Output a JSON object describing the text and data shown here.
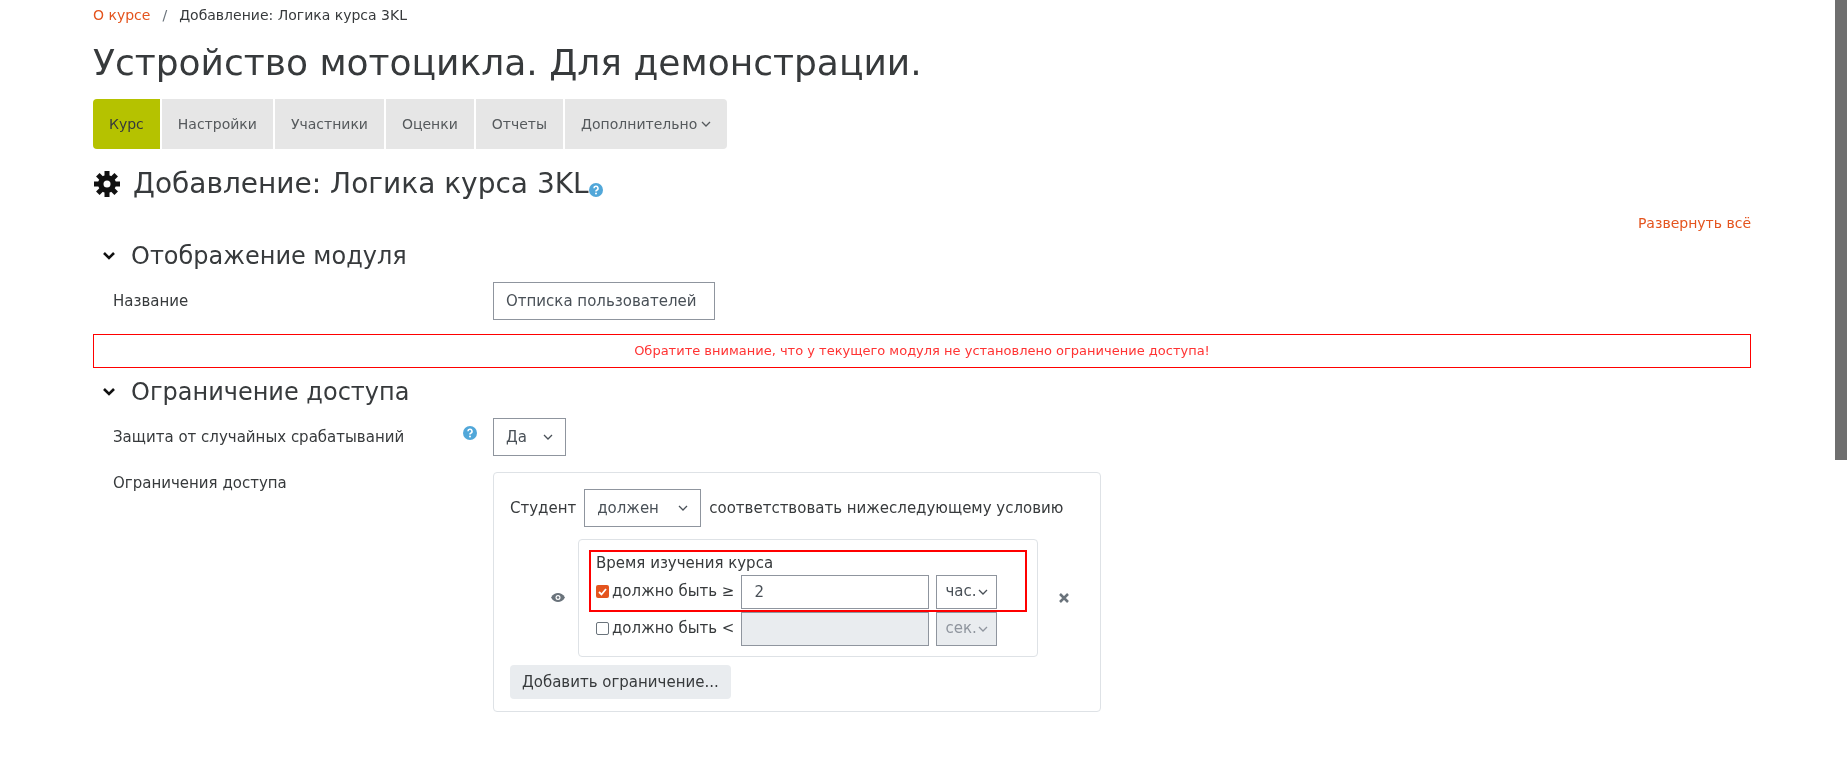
{
  "breadcrumb_separator": "/",
  "breadcrumb": [
    {
      "label": "О курсе",
      "link": true
    },
    {
      "label": "Добавление: Логика курса 3KL",
      "link": false
    }
  ],
  "course_title": "Устройство мотоцикла. Для демонстрации.",
  "tabs": [
    {
      "label": "Курс",
      "selected": true,
      "dropdown": false
    },
    {
      "label": "Настройки",
      "selected": false,
      "dropdown": false
    },
    {
      "label": "Участники",
      "selected": false,
      "dropdown": false
    },
    {
      "label": "Оценки",
      "selected": false,
      "dropdown": false
    },
    {
      "label": "Отчеты",
      "selected": false,
      "dropdown": false
    },
    {
      "label": "Дополнительно",
      "selected": false,
      "dropdown": true
    }
  ],
  "page_heading": "Добавление: Логика курса 3KL",
  "expand_all": "Развернуть всё",
  "sections": [
    {
      "title": "Отображение модуля",
      "expanded": true,
      "fields": [
        {
          "kind": "text",
          "label": "Название",
          "value": "Отписка пользователей"
        }
      ],
      "alert": "Обратите внимание, что у текущего модуля не установлено ограничение доступа!"
    },
    {
      "title": "Ограничение доступа",
      "expanded": true,
      "fields": [
        {
          "kind": "select",
          "label": "Защита от случайных срабатываний",
          "help": true,
          "value": "Да"
        },
        {
          "kind": "restrictions",
          "label": "Ограничения доступа"
        }
      ]
    }
  ],
  "restrictions": {
    "prefix": "Студент",
    "mode": "должен",
    "suffix": "соответствовать нижеследующему условию",
    "condition": {
      "title": "Время изучения курса",
      "highlighted": true,
      "rows": [
        {
          "checked": true,
          "label": "должно быть ≥",
          "value": "2",
          "unit": "час."
        },
        {
          "checked": false,
          "label": "должно быть <",
          "value": "",
          "unit": "сек."
        }
      ]
    },
    "add_button": "Добавить ограничение..."
  }
}
